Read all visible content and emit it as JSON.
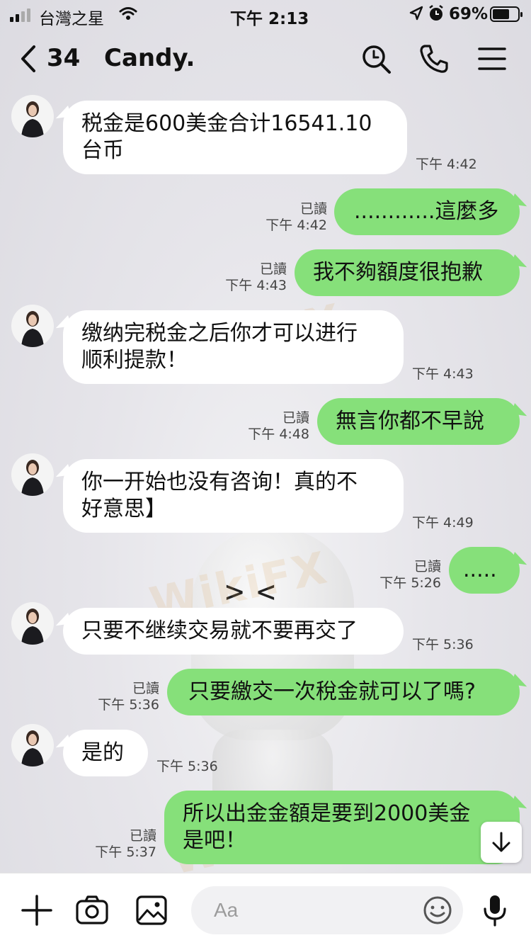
{
  "status_bar": {
    "carrier": "台灣之星",
    "time": "下午 2:13",
    "battery": "69%",
    "battery_level": 0.69,
    "icons": [
      "signal-icon",
      "wifi-icon",
      "location-icon",
      "alarm-icon",
      "battery-icon"
    ]
  },
  "header": {
    "back_count": "34",
    "title": "Candy.",
    "icons": [
      "back-icon",
      "search-icon",
      "phone-icon",
      "menu-icon"
    ]
  },
  "watermark": "WikiFX",
  "colors": {
    "outgoing_bubble": "#86e07a",
    "incoming_bubble": "#ffffff",
    "background": "#e4e3e8"
  },
  "messages": [
    {
      "direction": "in",
      "lines": [
        "税金是600美金合计16541.10",
        "台币"
      ],
      "time": "下午 4:42"
    },
    {
      "direction": "out",
      "lines": [
        "............這麼多"
      ],
      "read": "已讀",
      "time": "下午 4:42"
    },
    {
      "direction": "out",
      "lines": [
        "我不夠額度很抱歉"
      ],
      "read": "已讀",
      "time": "下午 4:43"
    },
    {
      "direction": "in",
      "lines": [
        "缴纳完税金之后你才可以进行",
        "顺利提款！"
      ],
      "time": "下午 4:43"
    },
    {
      "direction": "out",
      "lines": [
        "無言你都不早說"
      ],
      "read": "已讀",
      "time": "下午 4:48"
    },
    {
      "direction": "in",
      "lines": [
        "你一开始也没有咨询！真的不",
        "好意思】"
      ],
      "time": "下午 4:49"
    },
    {
      "direction": "out",
      "lines": [
        "....."
      ],
      "read": "已讀",
      "time": "下午 5:26"
    },
    {
      "direction": "in",
      "lines": [
        "只要不继续交易就不要再交了"
      ],
      "time": "下午 5:36"
    },
    {
      "direction": "out",
      "lines": [
        "只要繳交一次稅金就可以了嗎?"
      ],
      "read": "已讀",
      "time": "下午 5:36"
    },
    {
      "direction": "in",
      "lines": [
        "是的"
      ],
      "time": "下午 5:36"
    },
    {
      "direction": "out",
      "lines": [
        "所以出金金額是要到2000美金",
        "是吧！"
      ],
      "read": "已讀",
      "time": "下午 5:37"
    }
  ],
  "input_bar": {
    "placeholder": "Aa",
    "icons": [
      "plus-icon",
      "camera-icon",
      "image-icon",
      "emoji-icon",
      "mic-icon"
    ]
  }
}
